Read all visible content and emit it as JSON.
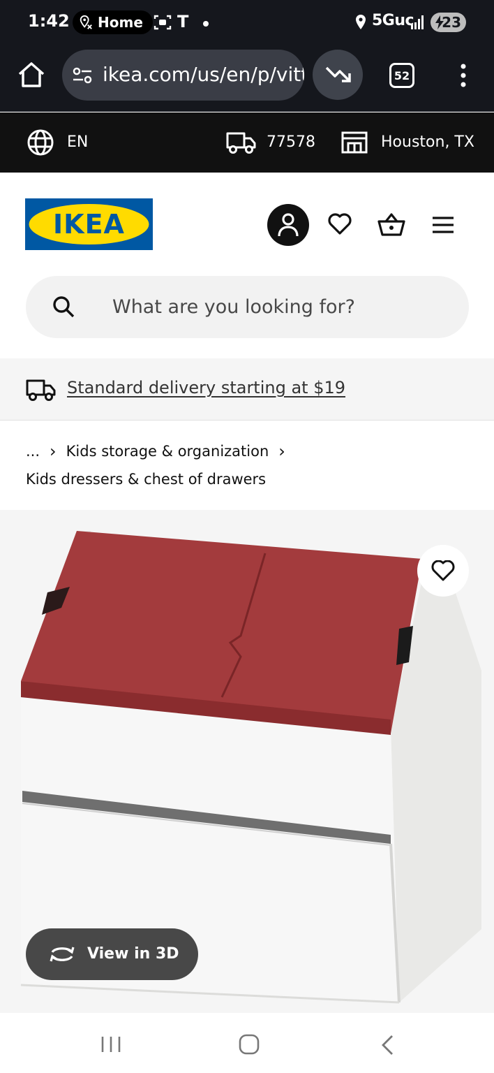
{
  "status_bar": {
    "time": "1:42",
    "home_pill": "Home",
    "t_indicator": "T",
    "network": "5Guc",
    "battery": "23",
    "icons": [
      "location-pin-icon",
      "face-scan-icon",
      "location-icon",
      "signal-icon",
      "battery-icon"
    ]
  },
  "browser": {
    "url": "ikea.com/us/en/p/vitt",
    "tab_count": "52",
    "icons": [
      "home-icon",
      "site-settings-icon",
      "trending-down-icon",
      "tab-switcher-icon",
      "overflow-menu-icon"
    ]
  },
  "ikea_strip": {
    "language": "EN",
    "zip": "77578",
    "store": "Houston, TX",
    "icons": [
      "globe-icon",
      "truck-icon",
      "store-icon"
    ]
  },
  "header": {
    "logo_text": "IKEA",
    "icons": [
      "account-icon",
      "heart-icon",
      "shopping-bag-icon",
      "hamburger-menu-icon"
    ],
    "brand_colors": {
      "blue": "#0058a3",
      "yellow": "#ffdb00"
    }
  },
  "search": {
    "placeholder": "What are you looking for?"
  },
  "delivery_banner": {
    "text": "Standard delivery starting at $19"
  },
  "breadcrumb": {
    "ellipsis": "...",
    "items": [
      "Kids storage & organization",
      "Kids dressers & chest of drawers"
    ]
  },
  "product": {
    "view_3d_label": "View in 3D",
    "lid_color": "#a33b3d",
    "body_color": "#f7f7f7"
  },
  "nav_bar": {
    "icons": [
      "recents-icon",
      "home-circle-icon",
      "back-icon"
    ]
  }
}
